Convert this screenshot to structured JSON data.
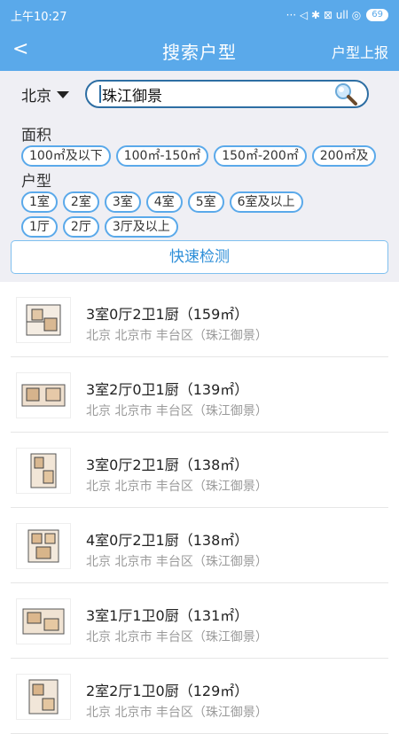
{
  "status": {
    "time": "上午10:27",
    "icons": "··· ◁ ✱ ⊠ ull ◎",
    "battery": "69"
  },
  "header": {
    "back": "<",
    "title": "搜索户型",
    "report": "户型上报"
  },
  "search": {
    "city": "北京",
    "value": "珠江御景"
  },
  "area": {
    "label": "面积",
    "chips": [
      "100㎡及以下",
      "100㎡-150㎡",
      "150㎡-200㎡",
      "200㎡及"
    ]
  },
  "layout": {
    "label": "户型",
    "rooms": [
      "1室",
      "2室",
      "3室",
      "4室",
      "5室",
      "6室及以上"
    ],
    "halls": [
      "1厅",
      "2厅",
      "3厅及以上"
    ]
  },
  "quick_button": "快速检测",
  "results": [
    {
      "title": "3室0厅2卫1厨（159㎡）",
      "sub": "北京 北京市 丰台区（珠江御景）"
    },
    {
      "title": "3室2厅0卫1厨（139㎡）",
      "sub": "北京 北京市 丰台区（珠江御景）"
    },
    {
      "title": "3室0厅2卫1厨（138㎡）",
      "sub": "北京 北京市 丰台区（珠江御景）"
    },
    {
      "title": "4室0厅2卫1厨（138㎡）",
      "sub": "北京 北京市 丰台区（珠江御景）"
    },
    {
      "title": "3室1厅1卫0厨（131㎡）",
      "sub": "北京 北京市 丰台区（珠江御景）"
    },
    {
      "title": "2室2厅1卫0厨（129㎡）",
      "sub": "北京 北京市 丰台区（珠江御景）"
    }
  ]
}
